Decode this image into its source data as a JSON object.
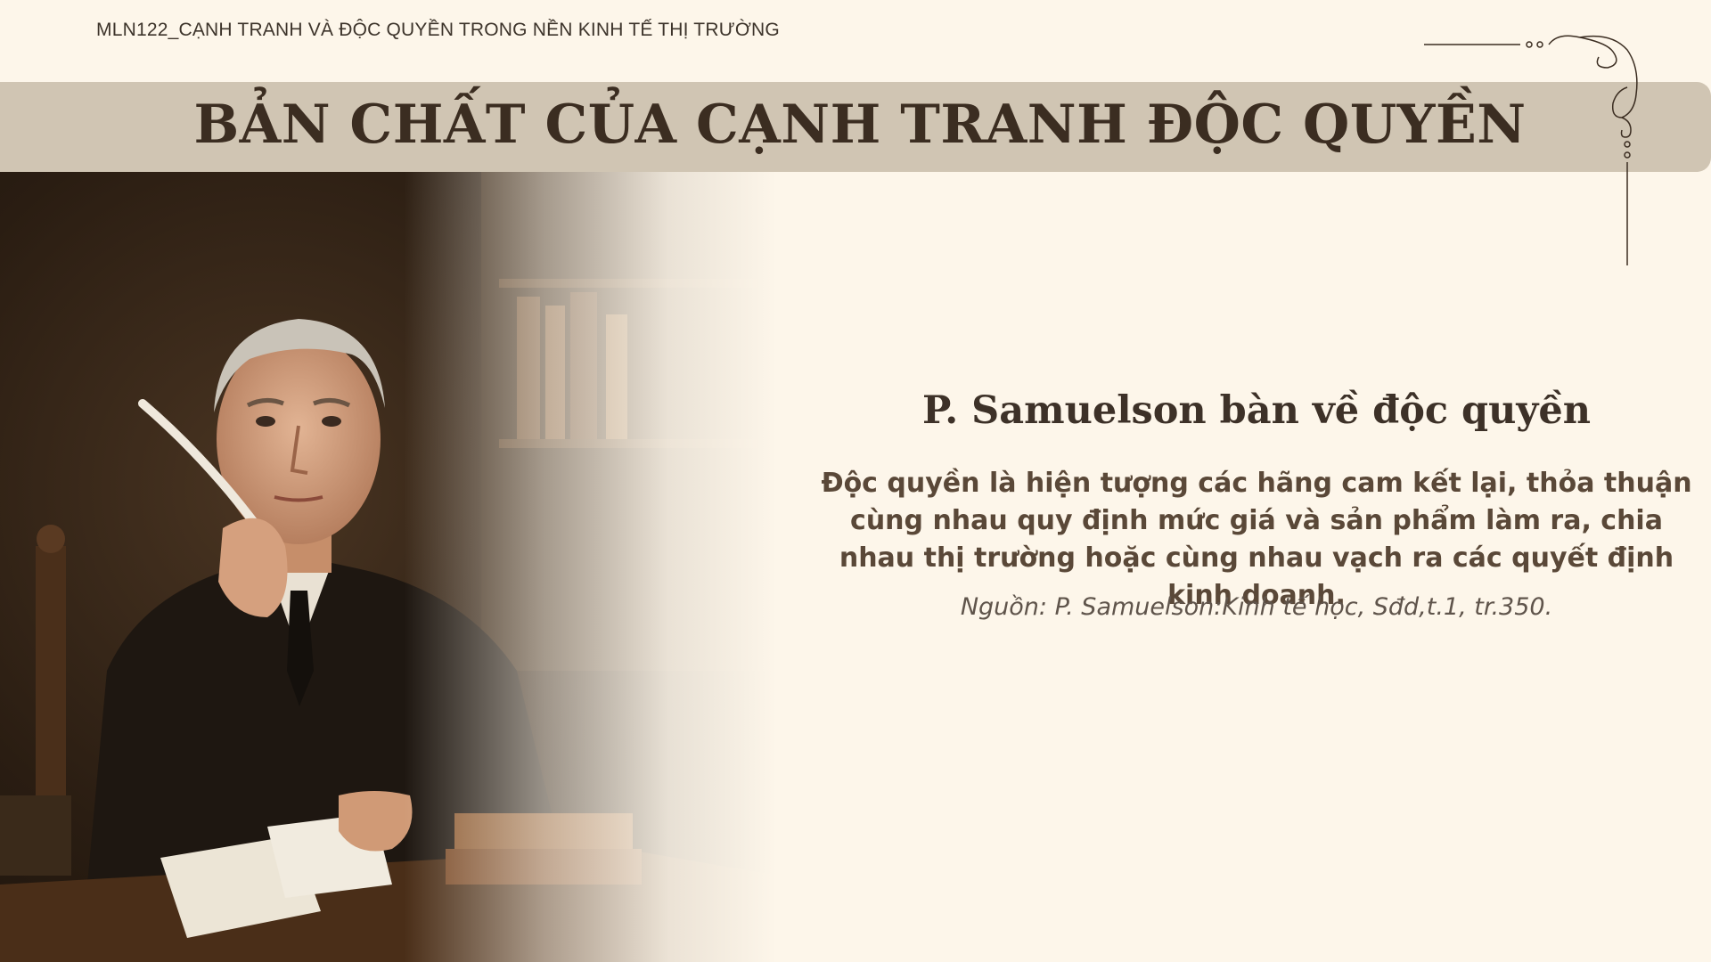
{
  "header": {
    "course_label": "MLN122_CẠNH TRANH VÀ ĐỘC QUYỀN TRONG NỀN KINH TẾ THỊ TRƯỜNG"
  },
  "slide": {
    "title": "BẢN CHẤT CỦA CẠNH TRANH ĐỘC QUYỀN"
  },
  "quote": {
    "heading": "P. Samuelson bàn về độc quyền",
    "body": "Độc quyền là hiện tượng các hãng cam kết lại, thỏa thuận cùng nhau quy định mức giá và sản phẩm làm ra, chia nhau thị trường hoặc cùng nhau vạch ra các quyết định kinh doanh.",
    "source": "Nguồn: P. Samuelson:Kinh tế học, Sđd,t.1, tr.350."
  },
  "image": {
    "subject": "portrait-of-scholar-with-quill"
  },
  "colors": {
    "background": "#fdf6ea",
    "title_band": "#d0c5b3",
    "title_text": "#3b2d21",
    "quote_body": "#5a4838"
  }
}
